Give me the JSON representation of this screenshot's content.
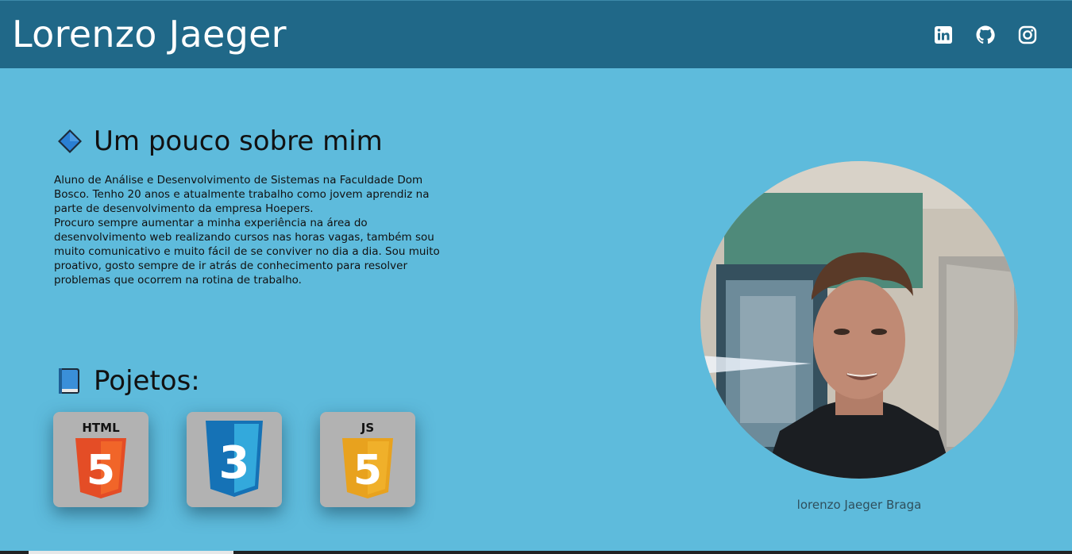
{
  "header": {
    "title": "Lorenzo Jaeger",
    "social": [
      {
        "name": "linkedin-icon"
      },
      {
        "name": "github-icon"
      },
      {
        "name": "instagram-icon"
      }
    ]
  },
  "about": {
    "icon": "diamond-icon",
    "heading": "Um pouco sobre mim",
    "paragraph1": "Aluno de Análise e Desenvolvimento de Sistemas na Faculdade Dom Bosco. Tenho 20 anos e atualmente trabalho como jovem aprendiz na parte de desenvolvimento da empresa Hoepers.",
    "paragraph2": "Procuro sempre aumentar a minha experiência na área do desenvolvimento web realizando cursos nas horas vagas, também sou muito comunicativo e muito fácil de se conviver no dia a dia. Sou muito proativo, gosto sempre de ir atrás de conhecimento para resolver problemas que ocorrem na rotina de trabalho."
  },
  "projects": {
    "icon": "book-icon",
    "heading": "Pojetos:",
    "items": [
      {
        "name": "html5-logo",
        "label": "HTML",
        "digit": "5",
        "color": "#e44d26"
      },
      {
        "name": "css3-logo",
        "digit": "3",
        "color": "#1572b6"
      },
      {
        "name": "js-logo",
        "label": "JS",
        "digit": "5",
        "color": "#f0b02a"
      }
    ]
  },
  "profile": {
    "caption": "lorenzo Jaeger Braga"
  },
  "colors": {
    "header_bg": "#206888",
    "page_bg": "#5ebbdc",
    "card_bg": "#b2b2b2"
  }
}
